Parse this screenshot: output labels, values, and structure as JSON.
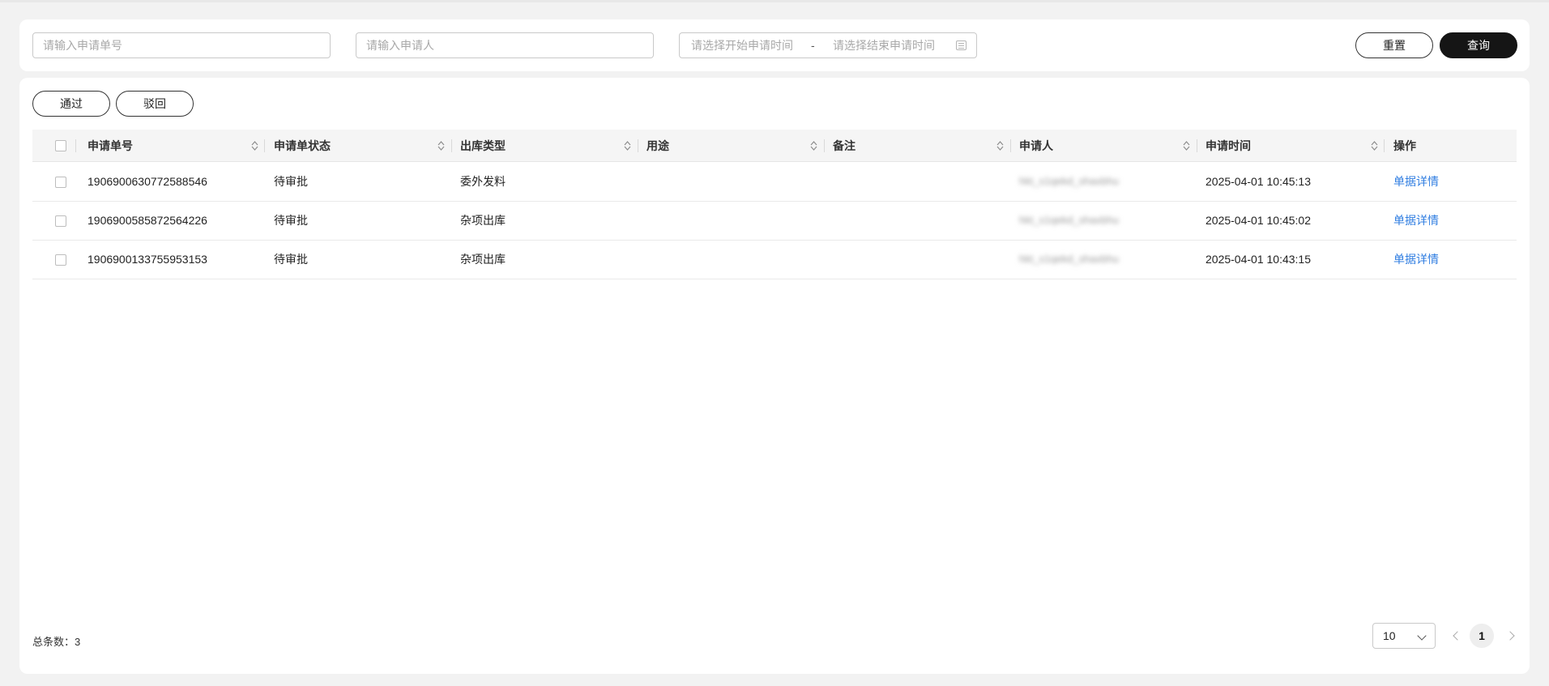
{
  "filters": {
    "order_no_placeholder": "请输入申请单号",
    "applicant_placeholder": "请输入申请人",
    "start_time_placeholder": "请选择开始申请时间",
    "range_separator": "-",
    "end_time_placeholder": "请选择结束申请时间",
    "reset_label": "重置",
    "query_label": "查询"
  },
  "actions": {
    "approve_label": "通过",
    "reject_label": "驳回"
  },
  "table": {
    "columns": [
      "申请单号",
      "申请单状态",
      "出库类型",
      "用途",
      "备注",
      "申请人",
      "申请时间",
      "操作"
    ],
    "rows": [
      {
        "order_no": "1906900630772588546",
        "status": "待审批",
        "type": "委外发料",
        "purpose": "",
        "remark": "",
        "applicant": "hkt_s1qekd_shaxbhu",
        "time": "2025-04-01 10:45:13",
        "action": "单据详情"
      },
      {
        "order_no": "1906900585872564226",
        "status": "待审批",
        "type": "杂项出库",
        "purpose": "",
        "remark": "",
        "applicant": "hkt_s1qekd_shaxbhu",
        "time": "2025-04-01 10:45:02",
        "action": "单据详情"
      },
      {
        "order_no": "1906900133755953153",
        "status": "待审批",
        "type": "杂项出库",
        "purpose": "",
        "remark": "",
        "applicant": "hkt_s1qekd_shaxbhu",
        "time": "2025-04-01 10:43:15",
        "action": "单据详情"
      }
    ]
  },
  "footer": {
    "total_label": "总条数：3",
    "page_size": "10",
    "current_page": "1"
  },
  "colors": {
    "link": "#2f7de1",
    "dark_button": "#151515",
    "background": "#f2f2f2"
  }
}
